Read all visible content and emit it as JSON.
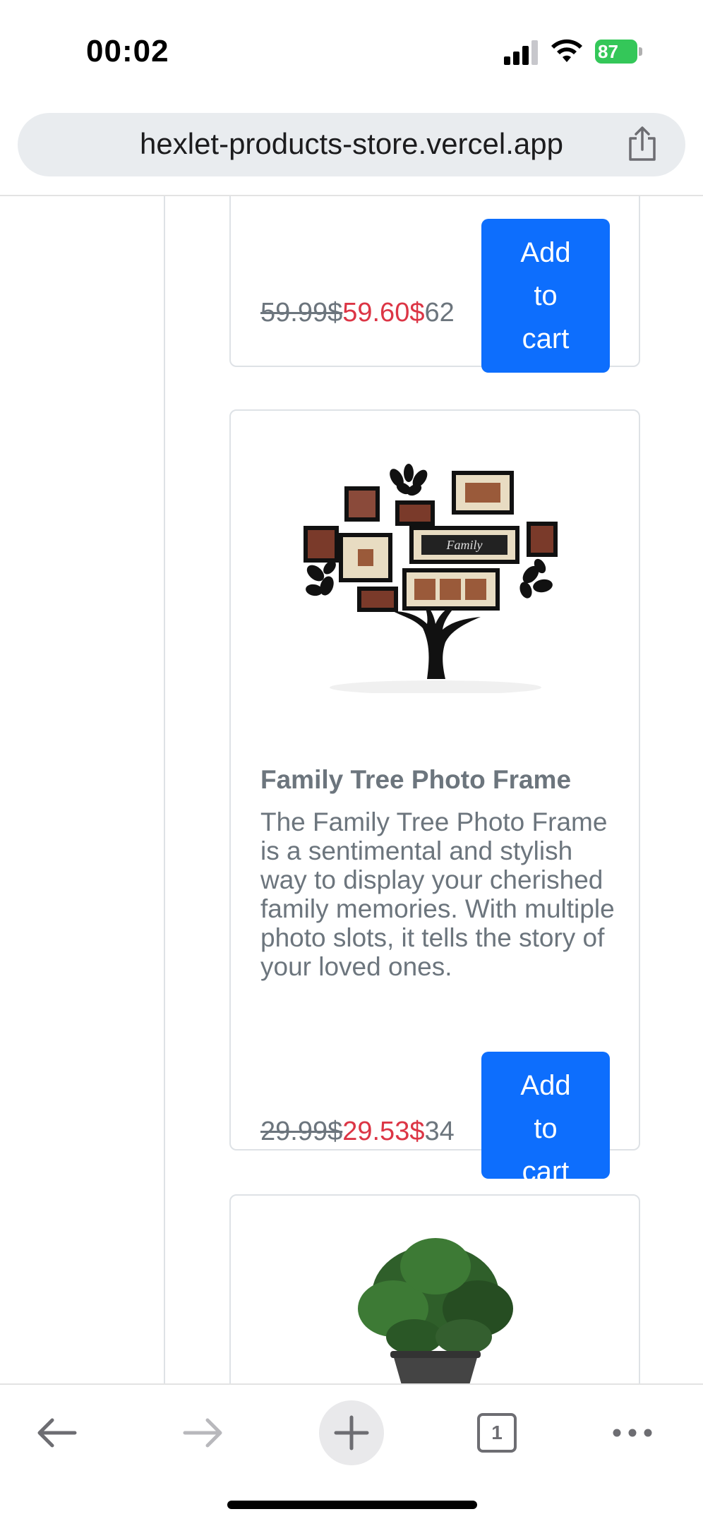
{
  "status_bar": {
    "time": "00:02",
    "battery_level": "87",
    "icons": [
      "signal-icon",
      "wifi-icon",
      "battery-charging-icon"
    ]
  },
  "browser": {
    "url": "hexlet-products-store.vercel.app",
    "share_icon": "share-icon",
    "toolbar": {
      "tab_count": "1",
      "icons": [
        "back-arrow-icon",
        "forward-arrow-icon",
        "new-tab-plus-icon",
        "tabs-icon",
        "more-dots-icon"
      ]
    }
  },
  "products": [
    {
      "title": "",
      "description": "",
      "price_old": "59.99$",
      "price_new": "59.60$",
      "price_alt": "62",
      "button": [
        "Add",
        "to",
        "cart"
      ]
    },
    {
      "title": "Family Tree Photo Frame",
      "description": "The Family Tree Photo Frame is a sentimental and stylish way to display your cherished family memories. With multiple photo slots, it tells the story of your loved ones.",
      "image_label": "Family",
      "price_old": "29.99$",
      "price_new": "29.53$",
      "price_alt": "34",
      "button": [
        "Add",
        "to",
        "cart"
      ]
    },
    {
      "title": "",
      "image": "potted-plant"
    }
  ],
  "colors": {
    "primary": "#0d6efd",
    "danger": "#dc3545",
    "muted": "#6c757d",
    "border": "#dee2e6",
    "battery": "#34c759"
  }
}
